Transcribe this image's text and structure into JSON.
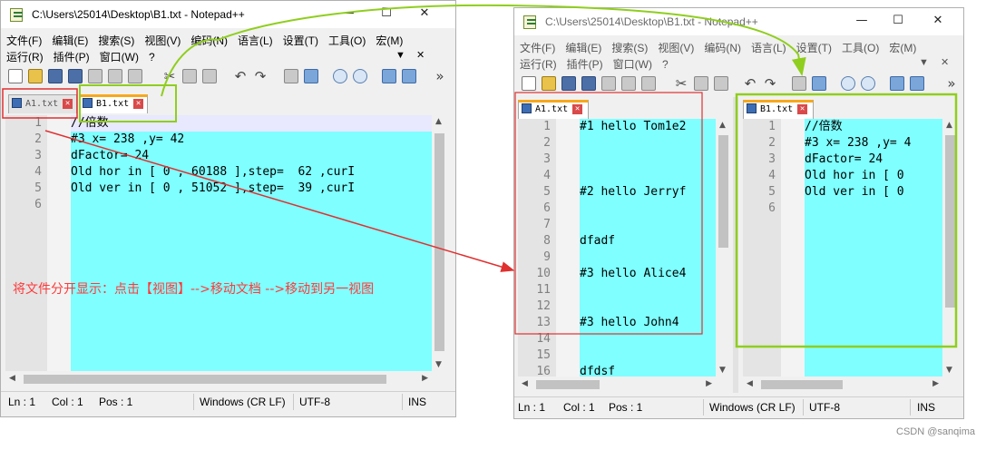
{
  "left_window": {
    "title": "C:\\Users\\25014\\Desktop\\B1.txt - Notepad++",
    "menu_row1": [
      "文件(F)",
      "编辑(E)",
      "搜索(S)",
      "视图(V)",
      "编码(N)",
      "语言(L)",
      "设置(T)",
      "工具(O)",
      "宏(M)"
    ],
    "menu_row2": [
      "运行(R)",
      "插件(P)",
      "窗口(W)",
      "?"
    ],
    "tabs": [
      {
        "label": "A1.txt",
        "active": false
      },
      {
        "label": "B1.txt",
        "active": true
      }
    ],
    "lines": [
      "//倍数",
      "#3 x= 238 ,y= 42",
      "dFactor= 24",
      "Old hor in [ 0 , 60188 ],step=  62 ,curI",
      "Old ver in [ 0 , 51052 ],step=  39 ,curI",
      ""
    ],
    "line_numbers": [
      "1",
      "2",
      "3",
      "4",
      "5",
      "6"
    ],
    "status": {
      "ln": "Ln : 1",
      "col": "Col : 1",
      "pos": "Pos : 1",
      "eol": "Windows (CR LF)",
      "enc": "UTF-8",
      "mode": "INS"
    }
  },
  "right_window": {
    "title": "C:\\Users\\25014\\Desktop\\B1.txt - Notepad++",
    "menu_row1": [
      "文件(F)",
      "编辑(E)",
      "搜索(S)",
      "视图(V)",
      "编码(N)",
      "语言(L)",
      "设置(T)",
      "工具(O)",
      "宏(M)"
    ],
    "menu_row2": [
      "运行(R)",
      "插件(P)",
      "窗口(W)",
      "?"
    ],
    "view1": {
      "tab": "A1.txt",
      "line_numbers": [
        "1",
        "2",
        "3",
        "4",
        "5",
        "6",
        "7",
        "8",
        "9",
        "10",
        "11",
        "12",
        "13",
        "14",
        "15",
        "16"
      ],
      "lines": [
        "#1 hello Tom1e2",
        "",
        "",
        "",
        "#2 hello Jerryf",
        "",
        "",
        "dfadf",
        "",
        "#3 hello Alice4",
        "",
        "",
        "#3 hello John4",
        "",
        "",
        "dfdsf"
      ]
    },
    "view2": {
      "tab": "B1.txt",
      "line_numbers": [
        "1",
        "2",
        "3",
        "4",
        "5",
        "6"
      ],
      "lines": [
        "//倍数",
        "#3 x= 238 ,y= 4",
        "dFactor= 24",
        "Old hor in [ 0",
        "Old ver in [ 0",
        ""
      ]
    },
    "status": {
      "ln": "Ln : 1",
      "col": "Col : 1",
      "pos": "Pos : 1",
      "eol": "Windows (CR LF)",
      "enc": "UTF-8",
      "mode": "INS"
    }
  },
  "annotation": "将文件分开显示：点击【视图】-->移动文档 -->移动到另一视图",
  "watermark": "CSDN @sanqima",
  "colors": {
    "editor_bg": "#7fffff",
    "annotation_red": "#ff3a3a",
    "annotation_green": "#8fce1e",
    "active_tab_accent": "#f7a81b"
  },
  "icons": {
    "caption": [
      "minimize-icon",
      "maximize-icon",
      "close-icon"
    ],
    "tab": "document-tab-icon",
    "close": "tab-close-icon"
  }
}
